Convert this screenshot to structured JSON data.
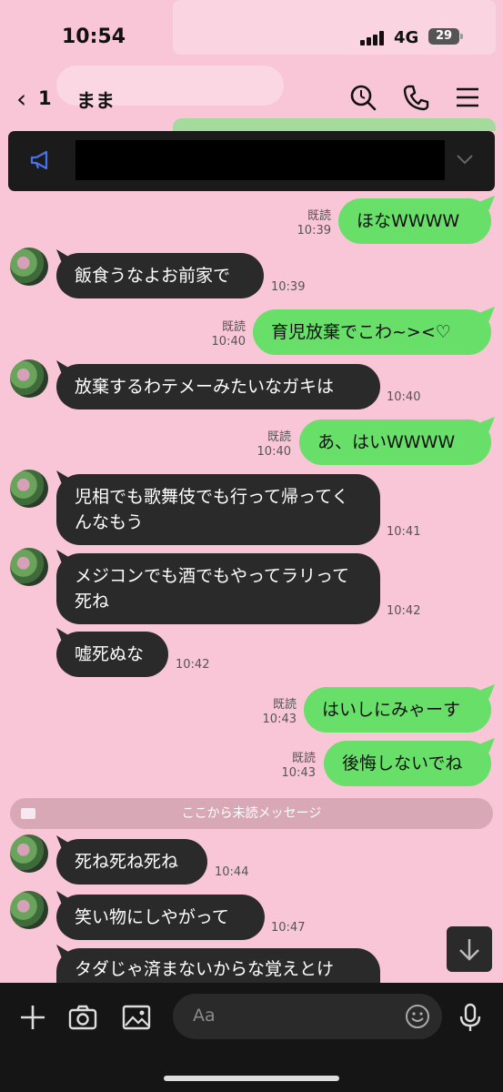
{
  "status_bar": {
    "time": "10:54",
    "network": "4G",
    "battery": "29"
  },
  "nav": {
    "back_count": "1",
    "title": "まま"
  },
  "notice": {
    "redacted": true
  },
  "messages": [
    {
      "side": "out",
      "text": "ほなWWWW",
      "read": "既読",
      "time": "10:39"
    },
    {
      "side": "in",
      "text": "飯食うなよお前家で",
      "time": "10:39"
    },
    {
      "side": "out",
      "text": "育児放棄でこわ~><♡",
      "read": "既読",
      "time": "10:40"
    },
    {
      "side": "in",
      "text": "放棄するわテメーみたいなガキは",
      "time": "10:40"
    },
    {
      "side": "out",
      "text": "あ、はいWWWW",
      "read": "既読",
      "time": "10:40"
    },
    {
      "side": "in",
      "text": "児相でも歌舞伎でも行って帰ってくんなもう",
      "time": "10:41"
    },
    {
      "side": "in",
      "text": "メジコンでも酒でもやってラリって死ね",
      "time": "10:42"
    },
    {
      "side": "in",
      "text": "嘘死ぬな",
      "time": "10:42"
    },
    {
      "side": "out",
      "text": "はいしにみゃーす",
      "read": "既読",
      "time": "10:43"
    },
    {
      "side": "out",
      "text": "後悔しないでね",
      "read": "既読",
      "time": "10:43"
    },
    {
      "side": "in",
      "text": "死ね死ね死ね",
      "time": "10:44"
    },
    {
      "side": "in",
      "text": "笑い物にしやがって",
      "time": "10:47"
    },
    {
      "side": "in",
      "text": "タダじゃ済まないからな覚えとけ",
      "time": ""
    }
  ],
  "unread_divider": "ここから未読メッセージ",
  "composer": {
    "placeholder": "Aa"
  },
  "colors": {
    "background": "#f8c6d6",
    "outgoing": "#67df69",
    "incoming": "#2a2a2a"
  }
}
